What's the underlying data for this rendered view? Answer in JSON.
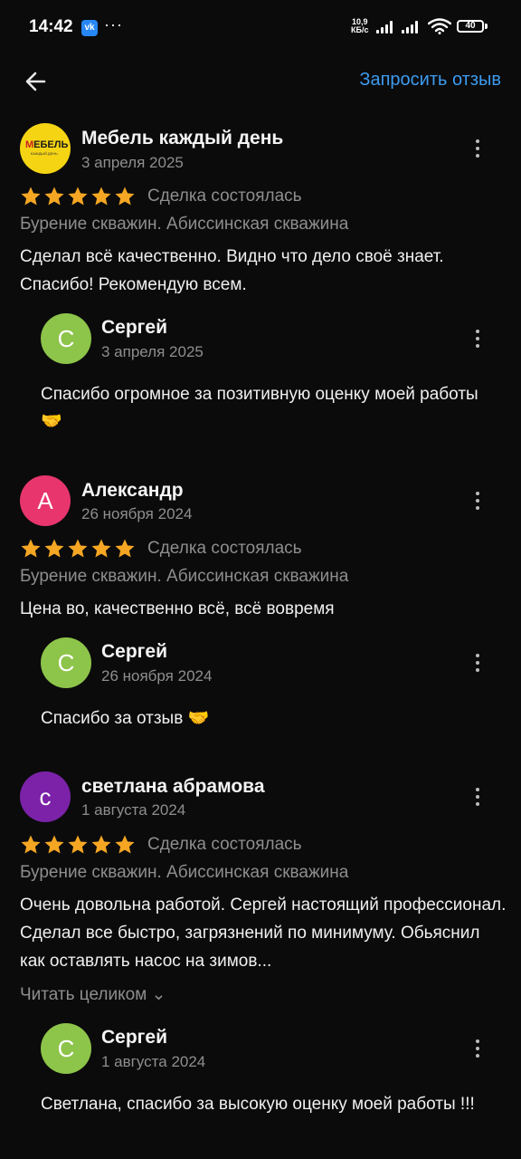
{
  "status_bar": {
    "time": "14:42",
    "net_speed_value": "10,9",
    "net_speed_unit": "КБ/с",
    "battery": "40",
    "app_icon": "vk-icon",
    "more": "···"
  },
  "toolbar": {
    "back_icon": "arrow-left-icon",
    "request_review": "Запросить отзыв"
  },
  "colors": {
    "accent": "#3d9bf0",
    "star": "#f5a623",
    "avatar_reply": "#8dc44a",
    "avatar_alexandr": "#e8356d",
    "avatar_svetlana": "#7b22a8",
    "logo_bg": "#f5d414"
  },
  "reviews": [
    {
      "author": "Мебель каждый день",
      "avatar_kind": "logo",
      "logo_text_a": "М",
      "logo_text_b": "ЕБЕЛЬ",
      "logo_sub": "КАЖДЫЙ ДЕНЬ",
      "date": "3 апреля 2025",
      "rating": 5,
      "status": "Сделка состоялась",
      "service": "Бурение скважин. Абиссинская скважина",
      "text": "Сделал всё качественно. Видно что дело своё знает. Спасибо! Рекомендую всем.",
      "reply": {
        "author": "Сергей",
        "initial": "С",
        "date": "3 апреля 2025",
        "text": "Спасибо огромное за позитивную оценку моей работы 🤝"
      }
    },
    {
      "author": "Александр",
      "avatar_kind": "initial",
      "initial": "А",
      "date": "26 ноября 2024",
      "rating": 5,
      "status": "Сделка состоялась",
      "service": "Бурение скважин. Абиссинская скважина",
      "text": "Цена во, качественно всё, всё вовремя",
      "reply": {
        "author": "Сергей",
        "initial": "С",
        "date": "26 ноября 2024",
        "text": "Спасибо за отзыв 🤝"
      }
    },
    {
      "author": "светлана абрамова",
      "avatar_kind": "initial",
      "initial": "с",
      "date": "1 августа 2024",
      "rating": 5,
      "status": "Сделка состоялась",
      "service": "Бурение скважин. Абиссинская скважина",
      "text": "Очень довольна работой. Сергей настоящий профессионал. Сделал все быстро, загрязнений по минимуму. Обьяснил как оставлять насос на зимов...",
      "read_more": "Читать целиком ⌄",
      "reply": {
        "author": "Сергей",
        "initial": "С",
        "date": "1 августа 2024",
        "text": "Светлана, спасибо за высокую оценку моей работы !!!"
      }
    }
  ]
}
